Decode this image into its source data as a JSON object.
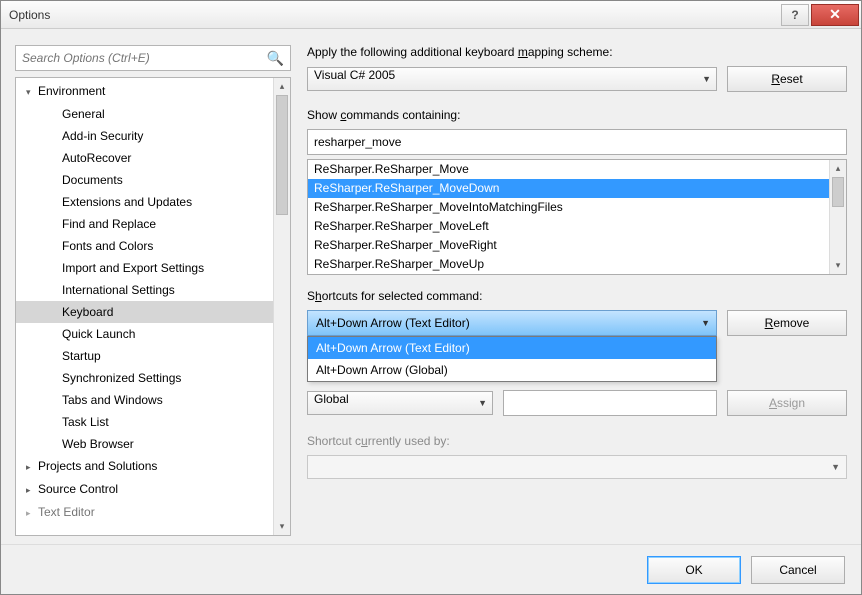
{
  "title": "Options",
  "search_placeholder": "Search Options (Ctrl+E)",
  "tree": {
    "environment": {
      "label": "Environment",
      "expanded": true
    },
    "children": [
      "General",
      "Add-in Security",
      "AutoRecover",
      "Documents",
      "Extensions and Updates",
      "Find and Replace",
      "Fonts and Colors",
      "Import and Export Settings",
      "International Settings",
      "Keyboard",
      "Quick Launch",
      "Startup",
      "Synchronized Settings",
      "Tabs and Windows",
      "Task List",
      "Web Browser"
    ],
    "selected_child_index": 9,
    "projects": "Projects and Solutions",
    "source_control": "Source Control",
    "text_editor": "Text Editor"
  },
  "right": {
    "mapping_label_pre": "Apply the following additional keyboard ",
    "mapping_label_u": "m",
    "mapping_label_post": "apping scheme:",
    "mapping_value": "Visual C# 2005",
    "reset_u": "R",
    "reset_post": "eset",
    "show_commands_pre": "Show ",
    "show_commands_u": "c",
    "show_commands_post": "ommands containing:",
    "filter_value": "resharper_move",
    "commands": [
      "ReSharper.ReSharper_Move",
      "ReSharper.ReSharper_MoveDown",
      "ReSharper.ReSharper_MoveIntoMatchingFiles",
      "ReSharper.ReSharper_MoveLeft",
      "ReSharper.ReSharper_MoveRight",
      "ReSharper.ReSharper_MoveUp"
    ],
    "commands_selected_index": 1,
    "shortcuts_label_pre": "S",
    "shortcuts_label_u": "h",
    "shortcuts_label_post": "ortcuts for selected command:",
    "shortcut_selected": "Alt+Down Arrow (Text Editor)",
    "shortcut_options": [
      "Alt+Down Arrow (Text Editor)",
      "Alt+Down Arrow (Global)"
    ],
    "shortcut_highlight_index": 0,
    "remove_u": "R",
    "remove_post": "emove",
    "scope_value": "Global",
    "assign_u": "A",
    "assign_post": "ssign",
    "used_label_pre": "Shortcut c",
    "used_label_u": "u",
    "used_label_post": "rrently used by:"
  },
  "footer": {
    "ok": "OK",
    "cancel": "Cancel"
  }
}
